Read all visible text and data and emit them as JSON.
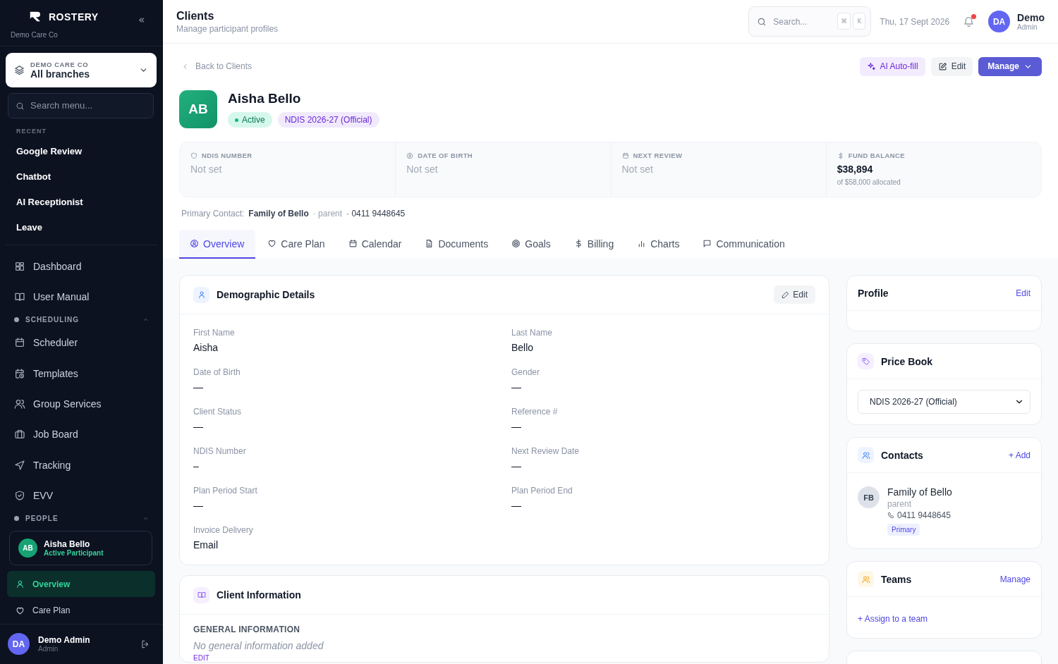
{
  "sidebar": {
    "brand": "ROSTERY",
    "org": "Demo Care Co",
    "branch_picker": {
      "label": "DEMO CARE CO",
      "value": "All branches"
    },
    "search": {
      "placeholder": "Search menu..."
    },
    "recent_heading": "RECENT",
    "recent": [
      "Google Review",
      "Chatbot",
      "AI Receptionist",
      "Leave"
    ],
    "nav": [
      "Dashboard",
      "User Manual"
    ],
    "sections": [
      {
        "title": "SCHEDULING",
        "expanded": true,
        "items": [
          "Scheduler",
          "Templates",
          "Group Services",
          "Job Board",
          "Tracking",
          "EVV"
        ]
      },
      {
        "title": "PEOPLE",
        "expanded": true
      }
    ],
    "client_card": {
      "initials": "AB",
      "name": "Aisha Bello",
      "status": "Active Participant"
    },
    "client_nav": [
      {
        "label": "Overview",
        "selected": true
      },
      {
        "label": "Care Plan",
        "selected": false
      }
    ],
    "user": {
      "initials": "DA",
      "name": "Demo Admin",
      "role": "Admin"
    }
  },
  "header": {
    "title": "Clients",
    "subtitle": "Manage participant profiles",
    "search": {
      "placeholder": "Search..."
    },
    "shortcut": [
      "⌘",
      "K"
    ],
    "date": "Thu, 17 Sept 2026",
    "unread": true,
    "user": {
      "initials": "DA",
      "name": "Demo",
      "role": "Admin"
    }
  },
  "back_link": "Back to Clients",
  "actions": [
    {
      "label": "AI Auto-fill",
      "kind": "ai"
    },
    {
      "label": "Edit",
      "kind": "secondary"
    },
    {
      "label": "Manage",
      "kind": "primary"
    }
  ],
  "client": {
    "initials": "AB",
    "name": "Aisha Bello",
    "status": "Active",
    "price_book": "NDIS 2026-27 (Official)"
  },
  "stats": [
    {
      "label": "NDIS NUMBER",
      "value": "Not set",
      "set": false
    },
    {
      "label": "DATE OF BIRTH",
      "value": "Not set",
      "set": false
    },
    {
      "label": "NEXT REVIEW",
      "value": "Not set",
      "set": false
    },
    {
      "label": "FUND BALANCE",
      "value": "$38,894",
      "set": true,
      "note": "of $58,000 allocated"
    }
  ],
  "primary_contact": {
    "label": "Primary Contact:",
    "name": "Family of Bello",
    "relation": "· parent",
    "phone": "· 0411 9448645"
  },
  "tabs": [
    {
      "label": "Overview",
      "selected": true
    },
    {
      "label": "Care Plan",
      "selected": false
    },
    {
      "label": "Calendar",
      "selected": false
    },
    {
      "label": "Documents",
      "selected": false
    },
    {
      "label": "Goals",
      "selected": false
    },
    {
      "label": "Billing",
      "selected": false
    },
    {
      "label": "Charts",
      "selected": false
    },
    {
      "label": "Communication",
      "selected": false
    }
  ],
  "demographics": {
    "title": "Demographic Details",
    "edit": "Edit",
    "fields": [
      {
        "label": "First Name",
        "value": "Aisha"
      },
      {
        "label": "Last Name",
        "value": "Bello"
      },
      {
        "label": "Date of Birth",
        "value": "—"
      },
      {
        "label": "Gender",
        "value": "—"
      },
      {
        "label": "Client Status",
        "value": "—"
      },
      {
        "label": "Reference #",
        "value": "—"
      },
      {
        "label": "NDIS Number",
        "value": "–"
      },
      {
        "label": "Next Review Date",
        "value": "—"
      },
      {
        "label": "Plan Period Start",
        "value": "—"
      },
      {
        "label": "Plan Period End",
        "value": "—"
      },
      {
        "label": "Invoice Delivery",
        "value": "Email"
      }
    ]
  },
  "client_information": {
    "title": "Client Information",
    "heading": "GENERAL INFORMATION",
    "empty": "No general information added",
    "edit": "EDIT"
  },
  "profile": {
    "title": "Profile",
    "edit": "Edit"
  },
  "price_book": {
    "title": "Price Book",
    "selected": "NDIS 2026-27 (Official)"
  },
  "contacts": {
    "title": "Contacts",
    "add": "+ Add",
    "items": [
      {
        "initials": "FB",
        "name": "Family of Bello",
        "relation": "parent",
        "phone": "0411 9448645",
        "tag": "Primary"
      }
    ]
  },
  "teams": {
    "title": "Teams",
    "manage": "Manage",
    "assign": "+ Assign to a team"
  }
}
